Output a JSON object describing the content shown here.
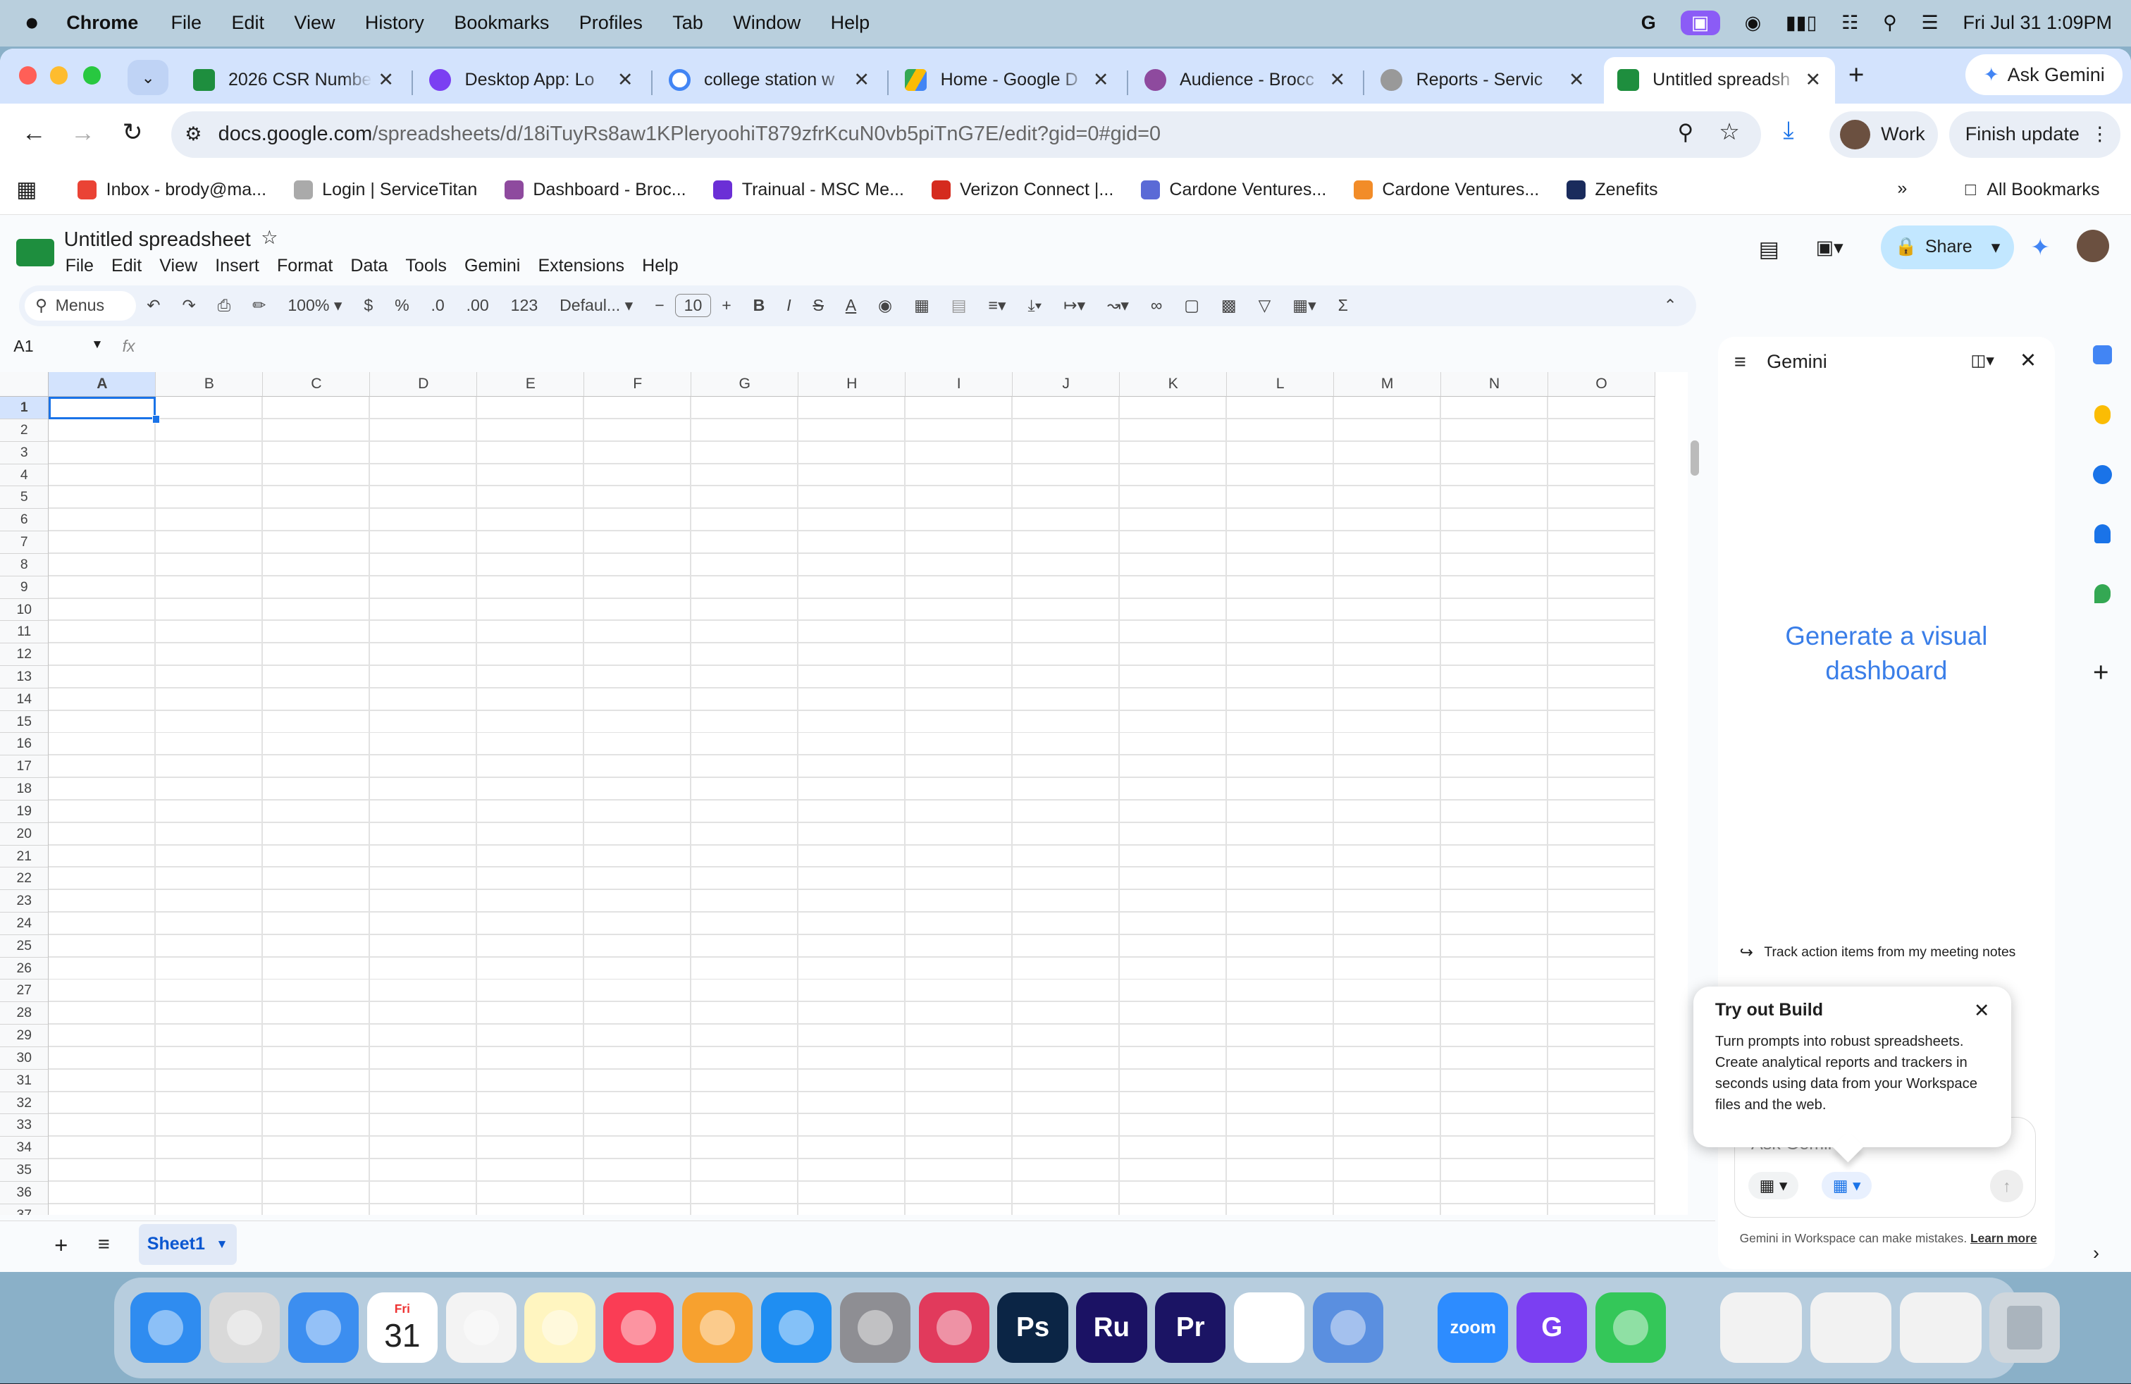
{
  "mac_menubar": {
    "app_name": "Chrome",
    "items": [
      "File",
      "Edit",
      "View",
      "History",
      "Bookmarks",
      "Profiles",
      "Tab",
      "Window",
      "Help"
    ],
    "clock": "Fri Jul 31  1:09PM"
  },
  "tabs": [
    {
      "title": "2026 CSR Numbe",
      "color": "#1e8e3e"
    },
    {
      "title": "Desktop App: Lo",
      "color": "#7b3ff2"
    },
    {
      "title": "college station w",
      "color": "#4285f4"
    },
    {
      "title": "Home - Google D",
      "color": "#fbbc04"
    },
    {
      "title": "Audience - Brocc",
      "color": "#8e4a9e"
    },
    {
      "title": "Reports - Servic",
      "color": "#888888"
    },
    {
      "title": "Untitled spreadsh",
      "color": "#1e8e3e",
      "active": true
    }
  ],
  "ask_gemini": "Ask Gemini",
  "address": {
    "domain": "docs.google.com",
    "path": "/spreadsheets/d/18iTuyRs8aw1KPleryoohiT879zfrKcuN0vb5piTnG7E/edit?gid=0#gid=0"
  },
  "profile": "Work",
  "finish_update": "Finish update",
  "bookmarks": [
    {
      "label": "Inbox - brody@ma...",
      "color": "#ea4335"
    },
    {
      "label": "Login | ServiceTitan",
      "color": "#aaaaaa"
    },
    {
      "label": "Dashboard - Broc...",
      "color": "#8e4a9e"
    },
    {
      "label": "Trainual - MSC Me...",
      "color": "#6b2fd6"
    },
    {
      "label": "Verizon Connect |...",
      "color": "#d52b1e"
    },
    {
      "label": "Cardone Ventures...",
      "color": "#5a6ad6"
    },
    {
      "label": "Cardone Ventures...",
      "color": "#f28c28"
    },
    {
      "label": "Zenefits",
      "color": "#1a2b5c"
    }
  ],
  "all_bookmarks": "All Bookmarks",
  "doc": {
    "title": "Untitled spreadsheet",
    "menu": [
      "File",
      "Edit",
      "View",
      "Insert",
      "Format",
      "Data",
      "Tools",
      "Gemini",
      "Extensions",
      "Help"
    ],
    "share": "Share"
  },
  "toolbar": {
    "search": "Menus",
    "zoom": "100%",
    "currency": "$",
    "percent": "%",
    "dec_less": ".0",
    "dec_more": ".00",
    "num_format": "123",
    "font": "Defaul...",
    "font_size": "10",
    "bold": "B",
    "italic": "I",
    "strike": "S",
    "text_color": "A",
    "sigma": "Σ"
  },
  "name_box": "A1",
  "fx": "fx",
  "columns": [
    "A",
    "B",
    "C",
    "D",
    "E",
    "F",
    "G",
    "H",
    "I",
    "J",
    "K",
    "L",
    "M",
    "N",
    "O"
  ],
  "rows": [
    "1",
    "2",
    "3",
    "4",
    "5",
    "6",
    "7",
    "8",
    "9",
    "10",
    "11",
    "12",
    "13",
    "14",
    "15",
    "16",
    "17",
    "18",
    "19",
    "20",
    "21",
    "22",
    "23",
    "24",
    "25",
    "26",
    "27",
    "28",
    "29",
    "30",
    "31",
    "32",
    "33",
    "34",
    "35",
    "36",
    "37"
  ],
  "sheet_tab": "Sheet1",
  "gemini": {
    "title": "Gemini",
    "headline": "Generate a visual dashboard",
    "suggestion": "Track action items from my meeting notes",
    "input_placeholder": "Ask Gemini",
    "disclaimer": "Gemini in Workspace can make mistakes.",
    "learn_more": "Learn more"
  },
  "popup": {
    "title": "Try out Build",
    "body": "Turn prompts into robust spreadsheets. Create analytical reports and trackers in seconds using data from your Workspace files and the web."
  },
  "dock": {
    "calendar_month": "Fri",
    "calendar_day": "31",
    "apps": [
      {
        "name": "Finder",
        "color": "#2f8cf0",
        "label": ""
      },
      {
        "name": "Launchpad",
        "color": "#d9d9d9",
        "label": ""
      },
      {
        "name": "Mail",
        "color": "#3c8ef0",
        "label": ""
      },
      {
        "name": "Calendar",
        "color": "#ffffff",
        "label": ""
      },
      {
        "name": "Photos",
        "color": "#f3f3f3",
        "label": ""
      },
      {
        "name": "Notes",
        "color": "#fff5c0",
        "label": ""
      },
      {
        "name": "Music",
        "color": "#fa3d55",
        "label": ""
      },
      {
        "name": "Pages",
        "color": "#f7a12f",
        "label": ""
      },
      {
        "name": "App Store",
        "color": "#1f8ef2",
        "label": ""
      },
      {
        "name": "System Settings",
        "color": "#8e8e93",
        "label": ""
      },
      {
        "name": "Creative Cloud",
        "color": "#e13a5c",
        "label": ""
      },
      {
        "name": "Photoshop",
        "color": "#0b2545",
        "label": "Ps"
      },
      {
        "name": "Rush",
        "color": "#1b1264",
        "label": "Ru"
      },
      {
        "name": "Premiere Pro",
        "color": "#1b1464",
        "label": "Pr"
      },
      {
        "name": "Chrome",
        "color": "#ffffff",
        "label": ""
      },
      {
        "name": "Simulator",
        "color": "#5a8fe0",
        "label": ""
      },
      {
        "name": "Zoom",
        "color": "#2d8cff",
        "label": "zoom"
      },
      {
        "name": "Grammarly",
        "color": "#7b3ff2",
        "label": "G"
      },
      {
        "name": "Phone",
        "color": "#34c759",
        "label": ""
      }
    ]
  }
}
